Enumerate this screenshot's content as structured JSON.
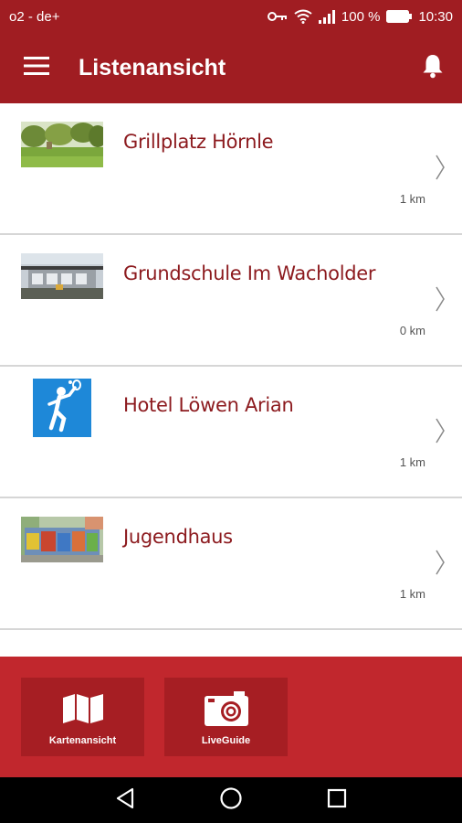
{
  "status_bar": {
    "carrier": "o2 - de+",
    "battery": "100 %",
    "time": "10:30",
    "icons": [
      "key-icon",
      "wifi-icon",
      "signal-icon",
      "battery-icon"
    ]
  },
  "app_bar": {
    "title": "Listenansicht",
    "menu_icon": "hamburger-menu-icon",
    "action_icon": "bell-icon"
  },
  "list": [
    {
      "title": "Grillplatz Hörnle",
      "distance": "1 km",
      "thumbnail": "park-photo"
    },
    {
      "title": "Grundschule Im Wacholder",
      "distance": "0 km",
      "thumbnail": "school-photo"
    },
    {
      "title": "Hotel Löwen Arian",
      "distance": "1 km",
      "thumbnail": "tennis-pictogram"
    },
    {
      "title": "Jugendhaus",
      "distance": "1 km",
      "thumbnail": "graffiti-photo"
    }
  ],
  "bottom_nav": {
    "map_label": "Kartenansicht",
    "map_icon": "map-icon",
    "liveguide_label": "LiveGuide",
    "liveguide_icon": "camera-icon"
  },
  "system_nav": [
    "back-icon",
    "home-icon",
    "recents-icon"
  ],
  "colors": {
    "primary": "#a01d22",
    "bottom_bar": "#c1272d",
    "tile": "#a61e23",
    "title_text": "#8c1a1e",
    "pictogram_blue": "#1e88d8"
  }
}
